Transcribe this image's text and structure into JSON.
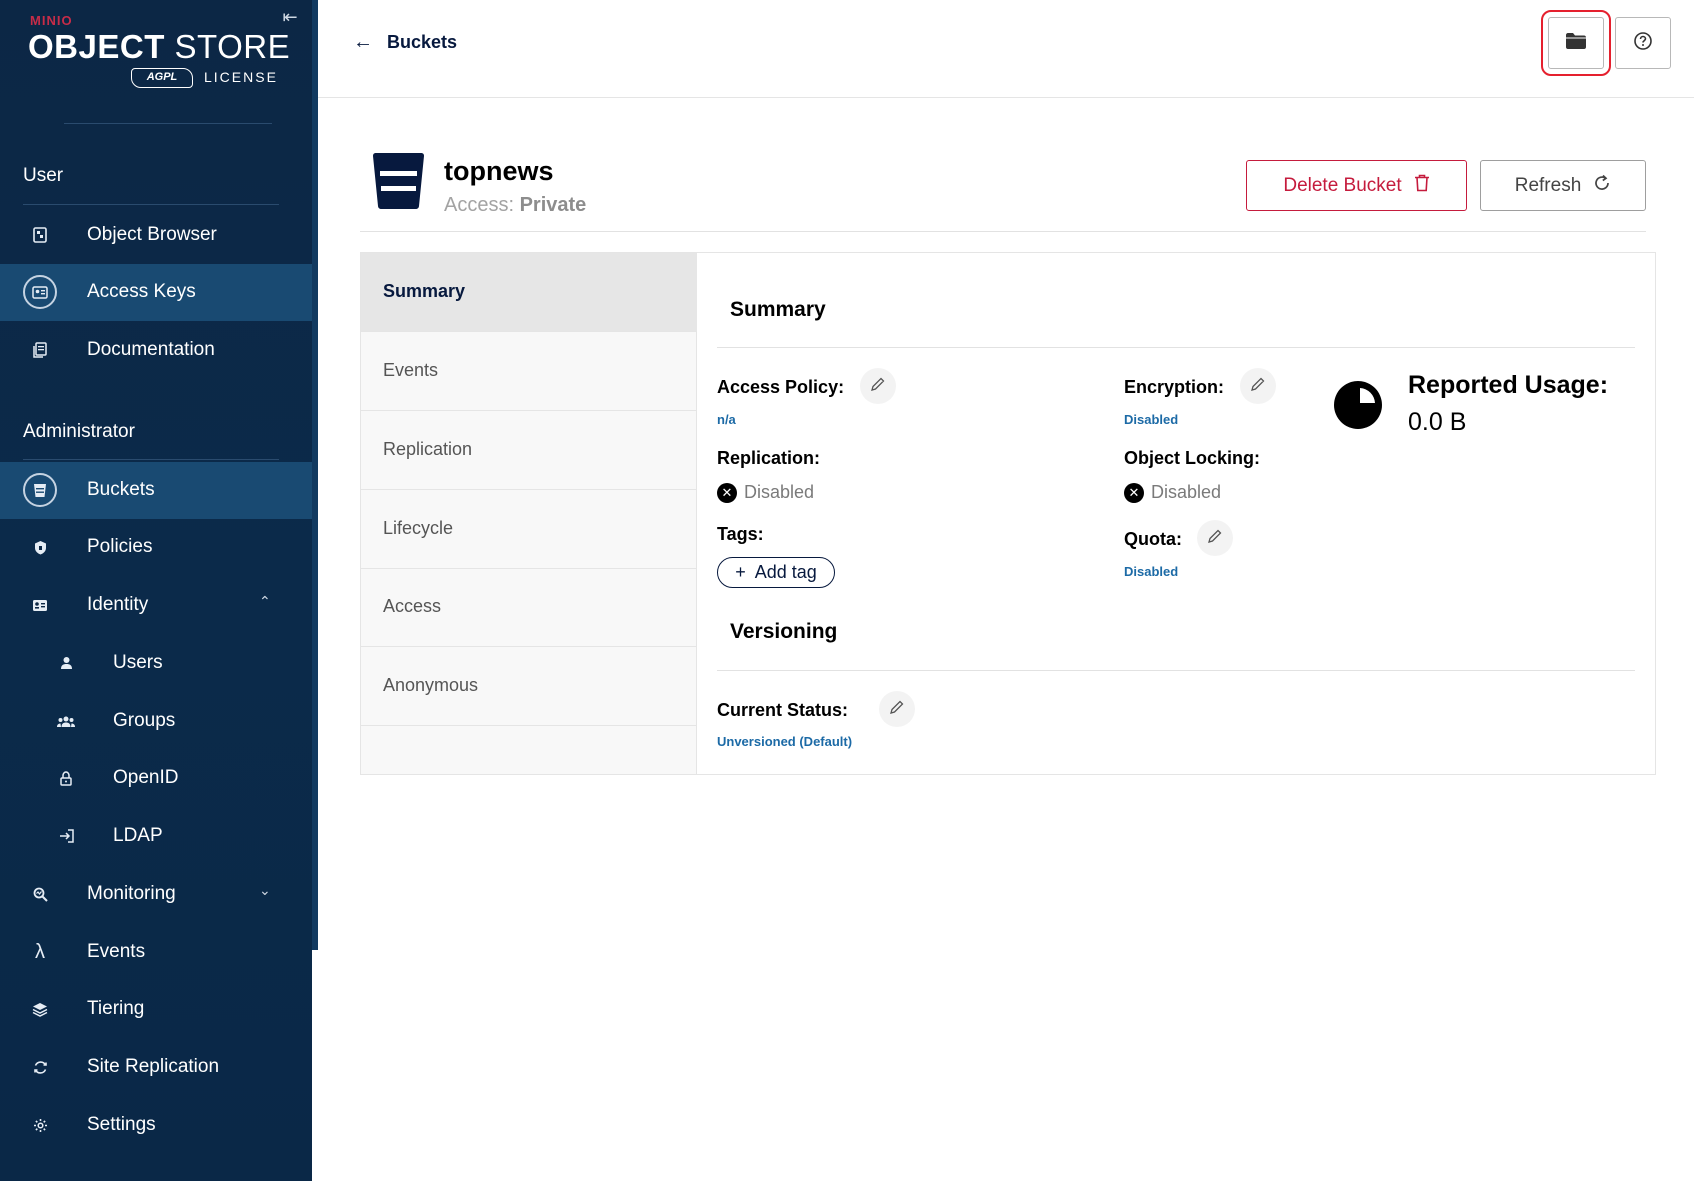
{
  "logo": {
    "brand": "MINIO",
    "product_bold": "OBJECT",
    "product_light": "STORE",
    "badge": "AGPL",
    "license": "LICENSE"
  },
  "sidebar": {
    "section_user": "User",
    "section_admin": "Administrator",
    "items": [
      {
        "label": "Object Browser",
        "icon": "object-browser-icon"
      },
      {
        "label": "Access Keys",
        "icon": "access-keys-icon"
      },
      {
        "label": "Documentation",
        "icon": "documentation-icon"
      },
      {
        "label": "Buckets",
        "icon": "buckets-icon"
      },
      {
        "label": "Policies",
        "icon": "policies-icon"
      },
      {
        "label": "Identity",
        "icon": "identity-icon"
      },
      {
        "label": "Users",
        "icon": "user-icon"
      },
      {
        "label": "Groups",
        "icon": "groups-icon"
      },
      {
        "label": "OpenID",
        "icon": "lock-icon"
      },
      {
        "label": "LDAP",
        "icon": "login-icon"
      },
      {
        "label": "Monitoring",
        "icon": "monitoring-icon"
      },
      {
        "label": "Events",
        "icon": "lambda-icon"
      },
      {
        "label": "Tiering",
        "icon": "layers-icon"
      },
      {
        "label": "Site Replication",
        "icon": "sync-icon"
      },
      {
        "label": "Settings",
        "icon": "gear-icon"
      }
    ]
  },
  "topbar": {
    "back_label": "Buckets"
  },
  "bucket": {
    "name": "topnews",
    "access_prefix": "Access:",
    "access_value": "Private",
    "delete_label": "Delete Bucket",
    "refresh_label": "Refresh"
  },
  "tabs": [
    "Summary",
    "Events",
    "Replication",
    "Lifecycle",
    "Access",
    "Anonymous"
  ],
  "summary": {
    "title": "Summary",
    "access_policy_label": "Access Policy:",
    "access_policy_value": "n/a",
    "replication_label": "Replication:",
    "replication_value": "Disabled",
    "tags_label": "Tags:",
    "add_tag_label": "Add tag",
    "encryption_label": "Encryption:",
    "encryption_value": "Disabled",
    "object_locking_label": "Object Locking:",
    "object_locking_value": "Disabled",
    "quota_label": "Quota:",
    "quota_value": "Disabled",
    "usage_title": "Reported Usage:",
    "usage_value": "0.0 B"
  },
  "versioning": {
    "title": "Versioning",
    "status_label": "Current Status:",
    "status_value": "Unversioned (Default)"
  },
  "colors": {
    "sidebar_bg": "#0b2a4a",
    "active_item": "#194a72",
    "danger": "#c51b3d",
    "link": "#1c6aa6",
    "highlight": "#e5202e"
  }
}
